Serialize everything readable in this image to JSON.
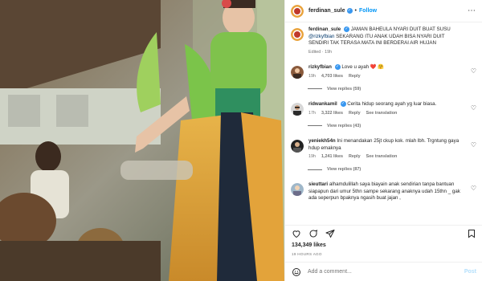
{
  "post": {
    "username": "ferdinan_sule",
    "follow_label": "Follow",
    "caption_user": "ferdinan_sule",
    "caption_text_1": "JAMAN BAHEULA NYARI DUIT BUAT SUSU",
    "caption_mention": "@rizkyfbian",
    "caption_text_2": "SEKARANG ITU ANAK UDAH BISA NYARI DUIT SENDIRI TAK TERASA MATA INI BERDERAI AIR HUJAN",
    "caption_meta": "Edited · 19h"
  },
  "comments": [
    {
      "user": "rizkyfbian",
      "text": "Love u ayah ❤️ 🤗",
      "time": "19h",
      "likes": "4,703 likes",
      "reply": "Reply",
      "extra": "",
      "view_replies": "View replies (59)"
    },
    {
      "user": "ridwankamil",
      "text": "Cerita hidup seorang ayah yg luar biasa.",
      "time": "17h",
      "likes": "3,322 likes",
      "reply": "Reply",
      "extra": "See translation",
      "view_replies": "View replies (43)"
    },
    {
      "user": "yeniekh54n",
      "text": "Ini menandakan 25jt ckup kok. mlah lbh. Trgntung gaya hdup emaknya",
      "time": "19h",
      "likes": "1,241 likes",
      "reply": "Reply",
      "extra": "See translation",
      "view_replies": "View replies (87)"
    },
    {
      "user": "sieuttari",
      "text": "alhamdulillah saya biayain anak sendirian tanpa bantuan siapapun dari umur 5thn sampe sekarang anaknya udah 15thn _ gak ada seperpun bpaknya ngasih buat jajan ,",
      "time": "",
      "likes": "",
      "reply": "",
      "extra": "",
      "view_replies": ""
    }
  ],
  "stats": {
    "likes": "134,349 likes",
    "ago": "19 HOURS AGO"
  },
  "composer": {
    "placeholder": "Add a comment...",
    "post_label": "Post"
  },
  "icons": {
    "more": "more-options-icon",
    "like": "heart-icon",
    "comment": "comment-icon",
    "share": "share-icon",
    "save": "bookmark-icon",
    "emoji": "emoji-icon"
  },
  "colors": {
    "follow": "#0095f6",
    "verified": "#3897f0",
    "heart_emoji": "#e0245e"
  }
}
